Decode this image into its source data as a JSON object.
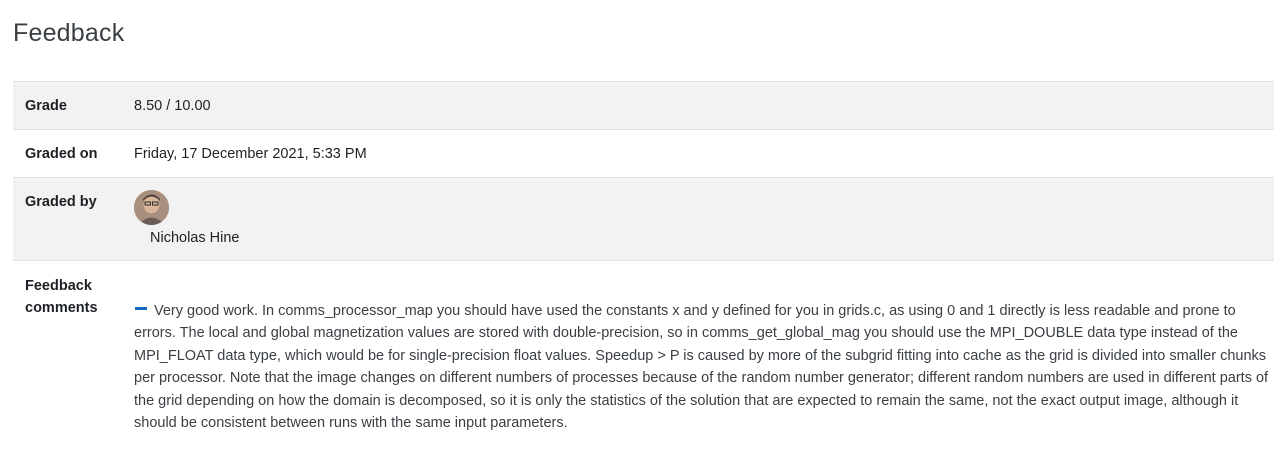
{
  "page": {
    "title": "Feedback"
  },
  "grade": {
    "label": "Grade",
    "value": "8.50 / 10.00"
  },
  "graded_on": {
    "label": "Graded on",
    "value": "Friday, 17 December 2021, 5:33 PM"
  },
  "graded_by": {
    "label": "Graded by",
    "name": "Nicholas Hine",
    "avatar_icon": "user-avatar-photo"
  },
  "feedback_comments": {
    "label_line1": "Feedback",
    "label_line2": "comments",
    "toggle_icon": "collapse-minus-icon",
    "text": "Very good work. In comms_processor_map you should have used the constants x and y defined for you in grids.c, as using 0 and 1 directly is less readable and prone to errors. The local and global magnetization values are stored with double-precision, so in comms_get_global_mag you should use the MPI_DOUBLE data type instead of the MPI_FLOAT data type, which would be for single-precision float values. Speedup > P is caused by more of the subgrid fitting into cache as the grid is divided into smaller chunks per processor. Note that the image changes on different numbers of processes because of the random number generator; different random numbers are used in different parts of the grid depending on how the domain is decomposed, so it is only the statistics of the solution that are expected to remain the same, not the exact output image, although it should be consistent between runs with the same input parameters."
  },
  "colors": {
    "accent": "#0f6cbf",
    "stripe": "#f2f2f2",
    "border": "#dee2e6"
  }
}
